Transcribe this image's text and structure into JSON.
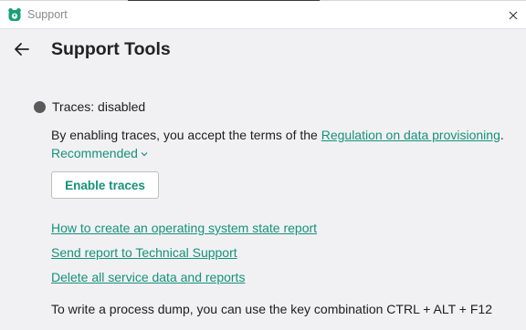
{
  "window": {
    "title": "Support"
  },
  "header": {
    "title": "Support Tools"
  },
  "traces": {
    "status_text": "Traces: disabled",
    "terms_prefix": "By enabling traces, you accept the terms of the ",
    "terms_link": "Regulation on data provisioning",
    "terms_suffix": ".",
    "recommended_label": "Recommended",
    "enable_button": "Enable traces"
  },
  "links": {
    "os_report": "How to create an operating system state report",
    "send_report": "Send report to Technical Support",
    "delete_data": "Delete all service data and reports"
  },
  "footer": {
    "dump_hint": "To write a process dump, you can use the key combination CTRL + ALT + F12"
  },
  "colors": {
    "accent": "#16927a",
    "status_dot": "#5a5a5a",
    "background": "#f1f1f4"
  },
  "icons": {
    "app": "app-logo-icon",
    "close": "close-icon",
    "back": "arrow-left-icon",
    "status": "status-dot-icon",
    "dropdown": "chevron-down-icon"
  }
}
